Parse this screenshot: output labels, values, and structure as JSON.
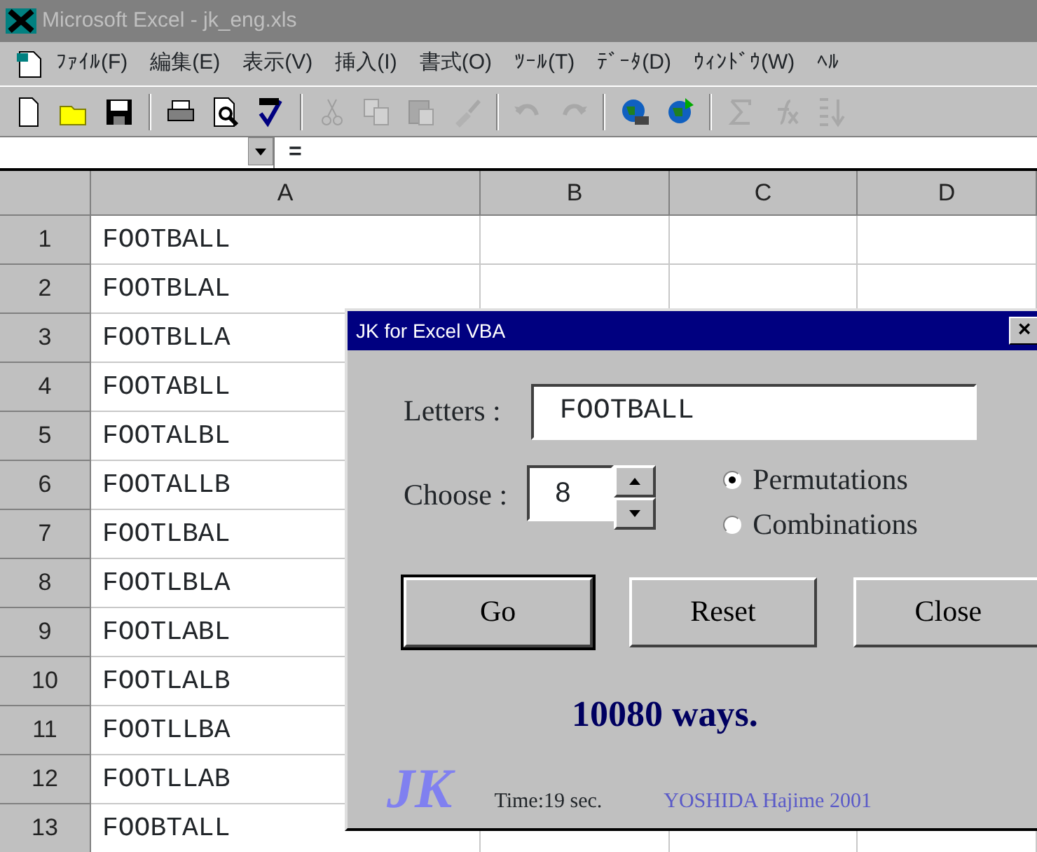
{
  "window": {
    "title": "Microsoft Excel - jk_eng.xls"
  },
  "menu": [
    "ﾌｧｲﾙ(F)",
    "編集(E)",
    "表示(V)",
    "挿入(I)",
    "書式(O)",
    "ﾂｰﾙ(T)",
    "ﾃﾞｰﾀ(D)",
    "ｳｨﾝﾄﾞｳ(W)",
    "ﾍﾙ"
  ],
  "toolbar": [
    {
      "kind": "new"
    },
    {
      "kind": "open"
    },
    {
      "kind": "save"
    },
    {
      "kind": "sep"
    },
    {
      "kind": "print"
    },
    {
      "kind": "preview"
    },
    {
      "kind": "spell"
    },
    {
      "kind": "sep"
    },
    {
      "kind": "cut",
      "disabled": true
    },
    {
      "kind": "copy",
      "disabled": true
    },
    {
      "kind": "paste",
      "disabled": true
    },
    {
      "kind": "brush",
      "disabled": true
    },
    {
      "kind": "sep"
    },
    {
      "kind": "undo",
      "disabled": true
    },
    {
      "kind": "redo",
      "disabled": true
    },
    {
      "kind": "sep"
    },
    {
      "kind": "globe"
    },
    {
      "kind": "globe2"
    },
    {
      "kind": "sep"
    },
    {
      "kind": "sum",
      "disabled": true
    },
    {
      "kind": "fx",
      "disabled": true
    },
    {
      "kind": "sort",
      "disabled": true
    }
  ],
  "formula_bar": {
    "equals": "="
  },
  "sheet": {
    "columns": [
      "A",
      "B",
      "C",
      "D"
    ],
    "rows": [
      {
        "number": "1",
        "cells": [
          "FOOTBALL",
          "",
          "",
          ""
        ]
      },
      {
        "number": "2",
        "cells": [
          "FOOTBLAL",
          "",
          "",
          ""
        ]
      },
      {
        "number": "3",
        "cells": [
          "FOOTBLLA",
          "",
          "",
          ""
        ]
      },
      {
        "number": "4",
        "cells": [
          "FOOTABLL",
          "",
          "",
          ""
        ]
      },
      {
        "number": "5",
        "cells": [
          "FOOTALBL",
          "",
          "",
          ""
        ]
      },
      {
        "number": "6",
        "cells": [
          "FOOTALLB",
          "",
          "",
          ""
        ]
      },
      {
        "number": "7",
        "cells": [
          "FOOTLBAL",
          "",
          "",
          ""
        ]
      },
      {
        "number": "8",
        "cells": [
          "FOOTLBLA",
          "",
          "",
          ""
        ]
      },
      {
        "number": "9",
        "cells": [
          "FOOTLABL",
          "",
          "",
          ""
        ]
      },
      {
        "number": "10",
        "cells": [
          "FOOTLALB",
          "",
          "",
          ""
        ]
      },
      {
        "number": "11",
        "cells": [
          "FOOTLLBA",
          "",
          "",
          ""
        ]
      },
      {
        "number": "12",
        "cells": [
          "FOOTLLAB",
          "",
          "",
          ""
        ]
      },
      {
        "number": "13",
        "cells": [
          "FOOBTALL",
          "",
          "",
          ""
        ]
      }
    ]
  },
  "dialog": {
    "title": "JK for Excel VBA",
    "close": "×",
    "letters_label": "Letters :",
    "letters_value": "FOOTBALL",
    "choose_label": "Choose :",
    "choose_value": "8",
    "options": [
      {
        "label": "Permutations",
        "selected": true
      },
      {
        "label": "Combinations",
        "selected": false
      }
    ],
    "buttons": [
      {
        "label": "Go",
        "default": true
      },
      {
        "label": "Reset",
        "default": false
      },
      {
        "label": "Close",
        "default": false
      }
    ],
    "result": "10080 ways.",
    "logo": "JK",
    "time": "Time:19 sec.",
    "credit": "YOSHIDA Hajime 2001"
  }
}
